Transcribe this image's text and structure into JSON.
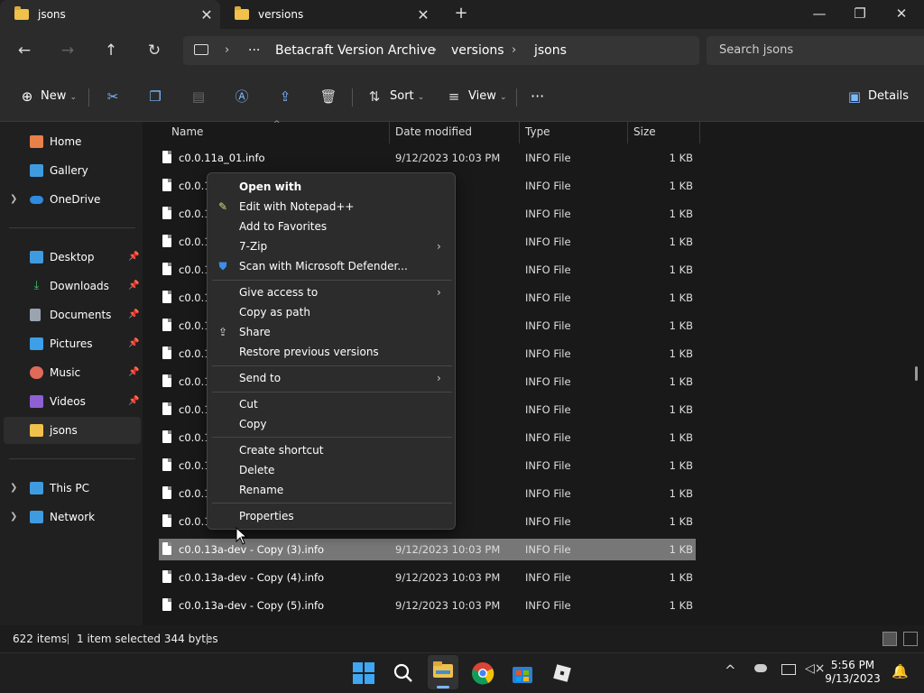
{
  "tabs": [
    {
      "label": "jsons",
      "close": "✕"
    },
    {
      "label": "versions",
      "close": "✕"
    }
  ],
  "new_tab": "+",
  "window": {
    "minimize": "—",
    "maximize": "❐",
    "close": "✕"
  },
  "nav": {
    "back": "←",
    "forward": "→",
    "up": "↑",
    "refresh": "↻"
  },
  "breadcrumb": {
    "more": "···",
    "sep": "›",
    "items": [
      "Betacraft Version Archive",
      "versions",
      "jsons"
    ]
  },
  "search": {
    "placeholder": "Search jsons"
  },
  "toolbar": {
    "new_label": "New",
    "sort_label": "Sort",
    "view_label": "View",
    "more": "···",
    "details_label": "Details"
  },
  "sidebar": {
    "top": [
      {
        "label": "Home",
        "icon": "home-icon"
      },
      {
        "label": "Gallery",
        "icon": "gallery-icon"
      },
      {
        "label": "OneDrive",
        "icon": "cloud-icon"
      }
    ],
    "quick": [
      {
        "label": "Desktop",
        "icon": "desktop-icon"
      },
      {
        "label": "Downloads",
        "icon": "download-icon"
      },
      {
        "label": "Documents",
        "icon": "document-icon"
      },
      {
        "label": "Pictures",
        "icon": "pictures-icon"
      },
      {
        "label": "Music",
        "icon": "music-icon"
      },
      {
        "label": "Videos",
        "icon": "videos-icon"
      },
      {
        "label": "jsons",
        "icon": "folder-icon"
      }
    ],
    "devices": [
      {
        "label": "This PC",
        "icon": "pc-icon"
      },
      {
        "label": "Network",
        "icon": "network-icon"
      }
    ]
  },
  "columns": {
    "name": "Name",
    "date": "Date modified",
    "type": "Type",
    "size": "Size"
  },
  "files": [
    {
      "name": "c0.0.11a_01.info",
      "date": "9/12/2023 10:03 PM",
      "type": "INFO File",
      "size": "1 KB"
    },
    {
      "name": "c0.0.1",
      "date": "03 PM",
      "type": "INFO File",
      "size": "1 KB"
    },
    {
      "name": "c0.0.1",
      "date": "03 PM",
      "type": "INFO File",
      "size": "1 KB"
    },
    {
      "name": "c0.0.1",
      "date": "03 PM",
      "type": "INFO File",
      "size": "1 KB"
    },
    {
      "name": "c0.0.1",
      "date": "03 PM",
      "type": "INFO File",
      "size": "1 KB"
    },
    {
      "name": "c0.0.1",
      "date": "03 PM",
      "type": "INFO File",
      "size": "1 KB"
    },
    {
      "name": "c0.0.1",
      "date": "03 PM",
      "type": "INFO File",
      "size": "1 KB"
    },
    {
      "name": "c0.0.1",
      "date": "03 PM",
      "type": "INFO File",
      "size": "1 KB"
    },
    {
      "name": "c0.0.1",
      "date": "03 PM",
      "type": "INFO File",
      "size": "1 KB"
    },
    {
      "name": "c0.0.1",
      "date": "03 PM",
      "type": "INFO File",
      "size": "1 KB"
    },
    {
      "name": "c0.0.1",
      "date": "03 PM",
      "type": "INFO File",
      "size": "1 KB"
    },
    {
      "name": "c0.0.1",
      "date": "03 PM",
      "type": "INFO File",
      "size": "1 KB"
    },
    {
      "name": "c0.0.1",
      "date": "03 PM",
      "type": "INFO File",
      "size": "1 KB"
    },
    {
      "name": "c0.0.1",
      "date": "03 PM",
      "type": "INFO File",
      "size": "1 KB"
    },
    {
      "name": "c0.0.13a-dev - Copy (3).info",
      "date": "9/12/2023 10:03 PM",
      "type": "INFO File",
      "size": "1 KB"
    },
    {
      "name": "c0.0.13a-dev - Copy (4).info",
      "date": "9/12/2023 10:03 PM",
      "type": "INFO File",
      "size": "1 KB"
    },
    {
      "name": "c0.0.13a-dev - Copy (5).info",
      "date": "9/12/2023 10:03 PM",
      "type": "INFO File",
      "size": "1 KB"
    }
  ],
  "status": {
    "count": "622 items",
    "selection": "1 item selected 344 bytes"
  },
  "context_menu": {
    "open_with": "Open with",
    "edit_notepad": "Edit with Notepad++",
    "add_favorites": "Add to Favorites",
    "seven_zip": "7-Zip",
    "scan_defender": "Scan with Microsoft Defender...",
    "give_access": "Give access to",
    "copy_path": "Copy as path",
    "share": "Share",
    "restore": "Restore previous versions",
    "send_to": "Send to",
    "cut": "Cut",
    "copy": "Copy",
    "create_shortcut": "Create shortcut",
    "delete": "Delete",
    "rename": "Rename",
    "properties": "Properties",
    "arrow": "›"
  },
  "clock": {
    "time": "5:56 PM",
    "date": "9/13/2023"
  },
  "colors": {
    "accent": "#7cb8ff",
    "folder": "#f0c14b",
    "selected_row": "#777777"
  }
}
